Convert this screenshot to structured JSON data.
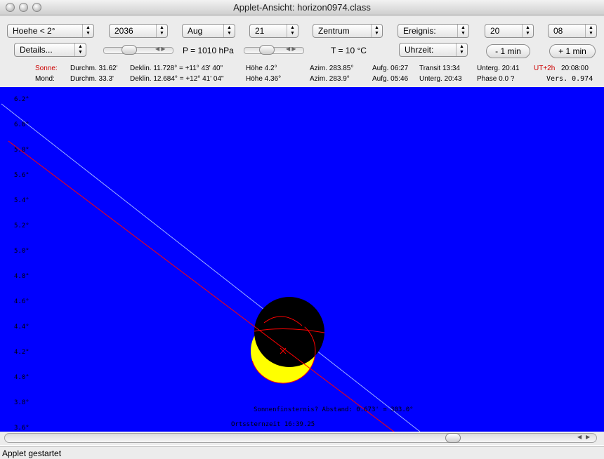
{
  "window": {
    "title": "Applet-Ansicht: horizon0974.class"
  },
  "controls": {
    "hoehe": "Hoehe < 2°",
    "year": "2036",
    "month": "Aug",
    "day": "21",
    "view": "Zentrum",
    "event": "Ereignis:",
    "hour": "20",
    "minute": "08",
    "details": "Details...",
    "pressure": "P = 1010 hPa",
    "temperature": "T = 10 °C",
    "time_mode": "Uhrzeit:",
    "minus_min": "- 1 min",
    "plus_min": "+ 1 min"
  },
  "info": {
    "sun": {
      "label": "Sonne:",
      "durchm": "Durchm. 31.62'",
      "deklin": "Deklin. 11.728° = +11° 43' 40\"",
      "hoehe": "Höhe 4.2°",
      "azim": "Azim. 283.85°",
      "aufg": "Aufg. 06:27",
      "transit": "Transit 13:34",
      "unterg": "Unterg. 20:41",
      "utc": "UT+2h",
      "time": "20:08:00"
    },
    "moon": {
      "label": "Mond:",
      "durchm": "Durchm. 33.3'",
      "deklin": "Deklin. 12.684° = +12° 41' 04\"",
      "hoehe": "Höhe 4.36°",
      "azim": "Azim. 283.9°",
      "aufg": "Aufg. 05:46",
      "unterg": "Unterg. 20:43",
      "phase": "Phase 0.0 ?",
      "version": "Vers. 0.974"
    }
  },
  "sky": {
    "colors": {
      "sky": "#0000ff",
      "sun": "#ffff00",
      "moon": "#000000",
      "sun_path": "#ff0000",
      "moon_path": "#9fb0ff",
      "labels": "#000000"
    },
    "alt_ticks": [
      "6.2°",
      "6.0°",
      "5.8°",
      "5.6°",
      "5.4°",
      "5.2°",
      "5.0°",
      "4.8°",
      "4.6°",
      "4.4°",
      "4.2°",
      "4.0°",
      "3.8°",
      "3.6°"
    ],
    "eclipse_text": "Sonnenfinsternis? Abstand: 0.673' = 303.0°",
    "sidereal_text": "Ortssternzeit 16:39.25"
  },
  "status": {
    "text": "Applet gestartet"
  }
}
